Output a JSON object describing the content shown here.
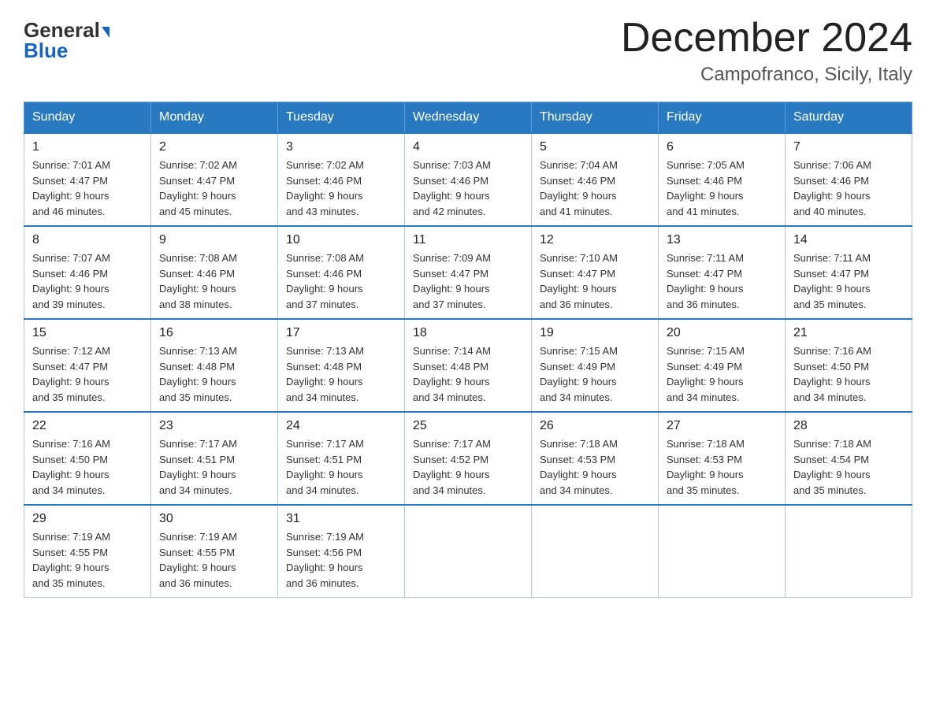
{
  "logo": {
    "general": "General",
    "blue": "Blue",
    "arrow": "▲"
  },
  "title": "December 2024",
  "location": "Campofranco, Sicily, Italy",
  "days_header": [
    "Sunday",
    "Monday",
    "Tuesday",
    "Wednesday",
    "Thursday",
    "Friday",
    "Saturday"
  ],
  "weeks": [
    [
      {
        "day": "1",
        "sunrise": "7:01 AM",
        "sunset": "4:47 PM",
        "daylight": "9 hours and 46 minutes."
      },
      {
        "day": "2",
        "sunrise": "7:02 AM",
        "sunset": "4:47 PM",
        "daylight": "9 hours and 45 minutes."
      },
      {
        "day": "3",
        "sunrise": "7:02 AM",
        "sunset": "4:46 PM",
        "daylight": "9 hours and 43 minutes."
      },
      {
        "day": "4",
        "sunrise": "7:03 AM",
        "sunset": "4:46 PM",
        "daylight": "9 hours and 42 minutes."
      },
      {
        "day": "5",
        "sunrise": "7:04 AM",
        "sunset": "4:46 PM",
        "daylight": "9 hours and 41 minutes."
      },
      {
        "day": "6",
        "sunrise": "7:05 AM",
        "sunset": "4:46 PM",
        "daylight": "9 hours and 41 minutes."
      },
      {
        "day": "7",
        "sunrise": "7:06 AM",
        "sunset": "4:46 PM",
        "daylight": "9 hours and 40 minutes."
      }
    ],
    [
      {
        "day": "8",
        "sunrise": "7:07 AM",
        "sunset": "4:46 PM",
        "daylight": "9 hours and 39 minutes."
      },
      {
        "day": "9",
        "sunrise": "7:08 AM",
        "sunset": "4:46 PM",
        "daylight": "9 hours and 38 minutes."
      },
      {
        "day": "10",
        "sunrise": "7:08 AM",
        "sunset": "4:46 PM",
        "daylight": "9 hours and 37 minutes."
      },
      {
        "day": "11",
        "sunrise": "7:09 AM",
        "sunset": "4:47 PM",
        "daylight": "9 hours and 37 minutes."
      },
      {
        "day": "12",
        "sunrise": "7:10 AM",
        "sunset": "4:47 PM",
        "daylight": "9 hours and 36 minutes."
      },
      {
        "day": "13",
        "sunrise": "7:11 AM",
        "sunset": "4:47 PM",
        "daylight": "9 hours and 36 minutes."
      },
      {
        "day": "14",
        "sunrise": "7:11 AM",
        "sunset": "4:47 PM",
        "daylight": "9 hours and 35 minutes."
      }
    ],
    [
      {
        "day": "15",
        "sunrise": "7:12 AM",
        "sunset": "4:47 PM",
        "daylight": "9 hours and 35 minutes."
      },
      {
        "day": "16",
        "sunrise": "7:13 AM",
        "sunset": "4:48 PM",
        "daylight": "9 hours and 35 minutes."
      },
      {
        "day": "17",
        "sunrise": "7:13 AM",
        "sunset": "4:48 PM",
        "daylight": "9 hours and 34 minutes."
      },
      {
        "day": "18",
        "sunrise": "7:14 AM",
        "sunset": "4:48 PM",
        "daylight": "9 hours and 34 minutes."
      },
      {
        "day": "19",
        "sunrise": "7:15 AM",
        "sunset": "4:49 PM",
        "daylight": "9 hours and 34 minutes."
      },
      {
        "day": "20",
        "sunrise": "7:15 AM",
        "sunset": "4:49 PM",
        "daylight": "9 hours and 34 minutes."
      },
      {
        "day": "21",
        "sunrise": "7:16 AM",
        "sunset": "4:50 PM",
        "daylight": "9 hours and 34 minutes."
      }
    ],
    [
      {
        "day": "22",
        "sunrise": "7:16 AM",
        "sunset": "4:50 PM",
        "daylight": "9 hours and 34 minutes."
      },
      {
        "day": "23",
        "sunrise": "7:17 AM",
        "sunset": "4:51 PM",
        "daylight": "9 hours and 34 minutes."
      },
      {
        "day": "24",
        "sunrise": "7:17 AM",
        "sunset": "4:51 PM",
        "daylight": "9 hours and 34 minutes."
      },
      {
        "day": "25",
        "sunrise": "7:17 AM",
        "sunset": "4:52 PM",
        "daylight": "9 hours and 34 minutes."
      },
      {
        "day": "26",
        "sunrise": "7:18 AM",
        "sunset": "4:53 PM",
        "daylight": "9 hours and 34 minutes."
      },
      {
        "day": "27",
        "sunrise": "7:18 AM",
        "sunset": "4:53 PM",
        "daylight": "9 hours and 35 minutes."
      },
      {
        "day": "28",
        "sunrise": "7:18 AM",
        "sunset": "4:54 PM",
        "daylight": "9 hours and 35 minutes."
      }
    ],
    [
      {
        "day": "29",
        "sunrise": "7:19 AM",
        "sunset": "4:55 PM",
        "daylight": "9 hours and 35 minutes."
      },
      {
        "day": "30",
        "sunrise": "7:19 AM",
        "sunset": "4:55 PM",
        "daylight": "9 hours and 36 minutes."
      },
      {
        "day": "31",
        "sunrise": "7:19 AM",
        "sunset": "4:56 PM",
        "daylight": "9 hours and 36 minutes."
      },
      null,
      null,
      null,
      null
    ]
  ],
  "labels": {
    "sunrise": "Sunrise:",
    "sunset": "Sunset:",
    "daylight": "Daylight:"
  }
}
